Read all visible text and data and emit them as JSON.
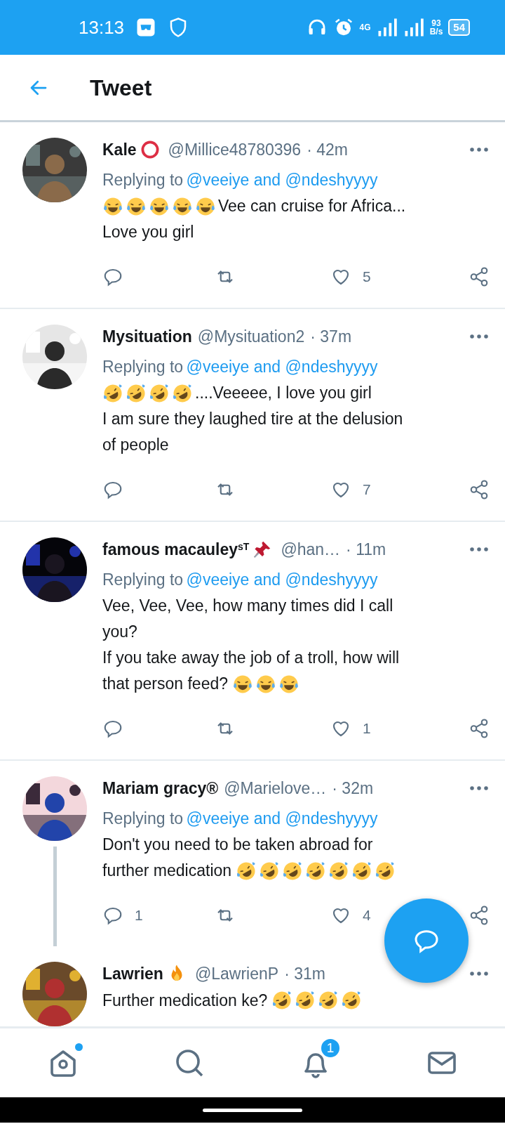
{
  "status_bar": {
    "time": "13:13",
    "network": "4G",
    "speed_value": "93",
    "speed_unit": "B/s",
    "battery": "54"
  },
  "header": {
    "title": "Tweet"
  },
  "tweets": [
    {
      "name": "Kale",
      "badges": [
        {
          "kind": "ring"
        }
      ],
      "handle": "@Millice48780396",
      "time": "· 42m",
      "replying_prefix": "Replying to",
      "replying_to": "@veeiye and @ndeshyyyy",
      "lines": [
        {
          "parts": [
            {
              "kind": "joy"
            },
            {
              "kind": "joy"
            },
            {
              "kind": "joy"
            },
            {
              "kind": "joy"
            },
            {
              "kind": "joy"
            },
            {
              "kind": "text",
              "text": "Vee can cruise for Africa..."
            }
          ]
        },
        {
          "parts": [
            {
              "kind": "text",
              "text": "Love you girl"
            }
          ]
        }
      ],
      "likes": "5",
      "thread_continues": false
    },
    {
      "name": "Mysituation",
      "handle": "@Mysituation2",
      "time": "· 37m",
      "replying_prefix": "Replying to",
      "replying_to": "@veeiye and @ndeshyyyy",
      "lines": [
        {
          "parts": [
            {
              "kind": "rofl"
            },
            {
              "kind": "rofl"
            },
            {
              "kind": "rofl"
            },
            {
              "kind": "rofl"
            },
            {
              "kind": "text",
              "text": "....Veeeee, I love you girl"
            }
          ]
        },
        {
          "parts": [
            {
              "kind": "text",
              "text": "I am sure they laughed tire at the delusion"
            }
          ]
        },
        {
          "parts": [
            {
              "kind": "text",
              "text": "of people"
            }
          ]
        }
      ],
      "likes": "7",
      "thread_continues": false
    },
    {
      "name": "famous macauley$^{sT}$",
      "badges": [
        {
          "kind": "pin"
        }
      ],
      "handle": "@han…",
      "time": "· 11m",
      "replying_prefix": "Replying to",
      "replying_to": "@veeiye and @ndeshyyyy",
      "lines": [
        {
          "parts": [
            {
              "kind": "text",
              "text": "Vee, Vee, Vee, how many times did I call"
            }
          ]
        },
        {
          "parts": [
            {
              "kind": "text",
              "text": "you?"
            }
          ]
        },
        {
          "parts": [
            {
              "kind": "text",
              "text": "If you take away the job of a troll, how will"
            }
          ]
        },
        {
          "parts": [
            {
              "kind": "text",
              "text": "that person feed?"
            },
            {
              "kind": "joy"
            },
            {
              "kind": "joy"
            },
            {
              "kind": "joy"
            }
          ]
        }
      ],
      "likes": "1",
      "thread_continues": false
    },
    {
      "name": "Mariam gracy®",
      "handle": "@Marielove…",
      "time": "· 32m",
      "replying_prefix": "Replying to",
      "replying_to": "@veeiye and @ndeshyyyy",
      "lines": [
        {
          "parts": [
            {
              "kind": "text",
              "text": "Don't you need to be taken abroad for"
            }
          ]
        },
        {
          "parts": [
            {
              "kind": "text",
              "text": "further medication"
            },
            {
              "kind": "rofl"
            },
            {
              "kind": "rofl"
            },
            {
              "kind": "rofl"
            },
            {
              "kind": "rofl"
            },
            {
              "kind": "rofl"
            },
            {
              "kind": "rofl"
            },
            {
              "kind": "rofl"
            }
          ]
        }
      ],
      "replies": "1",
      "likes": "4",
      "thread_continues": true
    },
    {
      "name": "Lawrien",
      "badges": [
        {
          "kind": "fire"
        }
      ],
      "handle": "@LawrienP",
      "time": "· 31m",
      "lines": [
        {
          "parts": [
            {
              "kind": "text",
              "text": "Further medication ke?"
            },
            {
              "kind": "rofl"
            },
            {
              "kind": "rofl"
            },
            {
              "kind": "rofl"
            },
            {
              "kind": "rofl"
            }
          ]
        }
      ],
      "thread_continues": false
    }
  ],
  "bottom_nav": [
    {
      "kind": "home",
      "new_dot": true
    },
    {
      "kind": "search",
      "new_dot": false
    },
    {
      "kind": "notifications",
      "new_dot": false,
      "badge": "1"
    },
    {
      "kind": "messages",
      "new_dot": false
    }
  ]
}
